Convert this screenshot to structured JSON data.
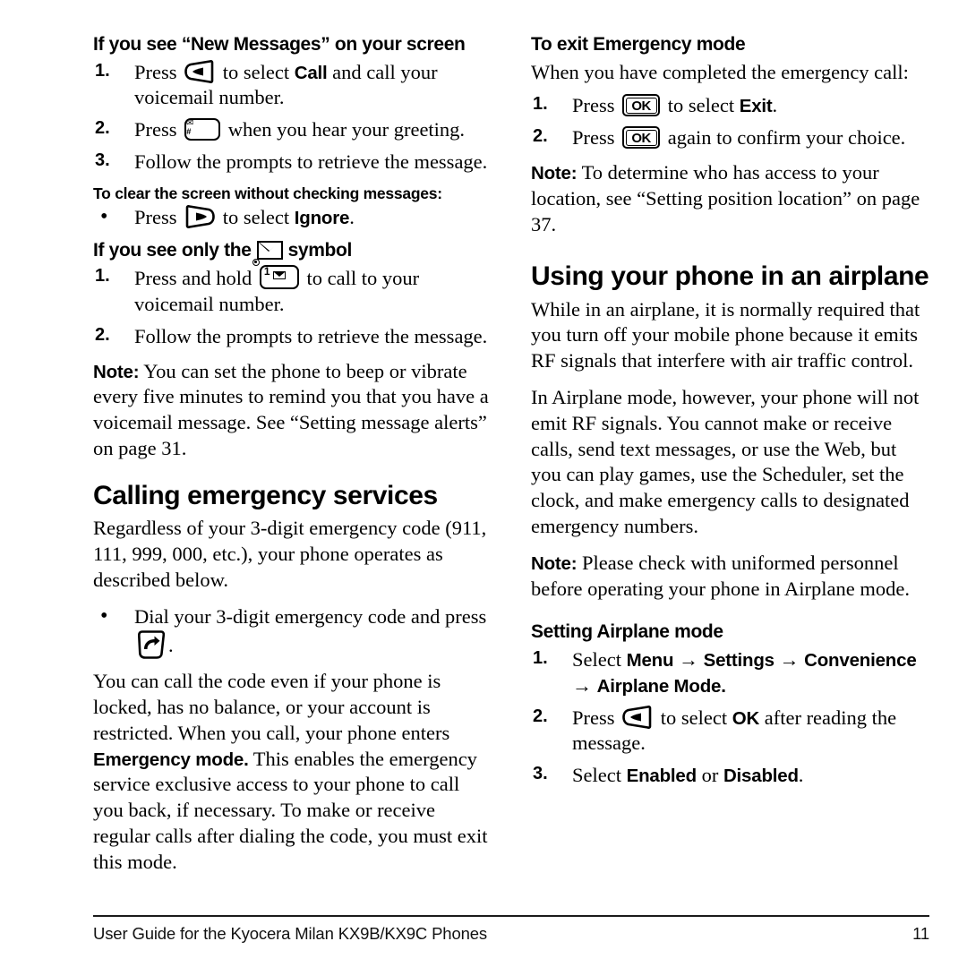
{
  "document": {
    "page_number": "11",
    "footer_text": "User Guide for the Kyocera Milan KX9B/KX9C Phones"
  },
  "left_column": {
    "heading_new_messages": "If you see “New Messages” on your screen",
    "steps_new_messages": [
      {
        "num": "1.",
        "pre": "Press",
        "icon": "left-softkey-icon",
        "mid": "to select",
        "bold": "Call",
        "post": "and call your voicemail number."
      },
      {
        "num": "2.",
        "pre": "Press",
        "icon": "space-pound-key-icon",
        "mid": "when you hear your greeting.",
        "bold": "",
        "post": ""
      },
      {
        "num": "3.",
        "pre": "Follow the prompts to retrieve the message.",
        "icon": "",
        "mid": "",
        "bold": "",
        "post": ""
      }
    ],
    "minor_heading_clear_screen": "To clear the screen without checking messages:",
    "bullet_ignore": {
      "pre": "Press",
      "icon": "right-softkey-icon",
      "mid": "to select",
      "bold": "Ignore",
      "post": "."
    },
    "heading_envelope_pre": "If you see only the",
    "heading_envelope_icon": "envelope-icon",
    "heading_envelope_post": "symbol",
    "steps_envelope": [
      {
        "num": "1.",
        "pre": "Press and hold",
        "icon": "voicemail-one-key-icon",
        "post": "to call to your voicemail number."
      },
      {
        "num": "2.",
        "pre": "Follow the prompts to retrieve the message.",
        "icon": "",
        "post": ""
      }
    ],
    "note_voicemail_label": "Note:",
    "note_voicemail_text": "You can set the phone to beep or vibrate every five minutes to remind you that you have a voicemail message. See “Setting message alerts” on page 31.",
    "heading_emergency": "Calling emergency services",
    "para_emergency_intro": "Regardless of your 3-digit emergency code (911, 111, 999, 000, etc.), your phone operates as described below.",
    "bullet_dial": {
      "pre": "Dial  your 3-digit emergency code and press",
      "icon": "send-talk-key-icon",
      "post": "."
    },
    "para_emergency_body_1": "You can call the code even if your phone is locked, has no balance, or your account is restricted. When you call, your phone enters ",
    "para_emergency_bold": "Emergency mode.",
    "para_emergency_body_2": " This enables the emergency service exclusive access to your phone to call you back, if necessary. To make or receive regular calls after dialing the code, you must exit this mode."
  },
  "right_column": {
    "heading_exit_emergency": "To exit Emergency mode",
    "para_exit_intro": "When you have completed the emergency call:",
    "steps_exit": [
      {
        "num": "1.",
        "pre": "Press",
        "icon": "ok-key-icon",
        "mid": "to select",
        "bold": "Exit",
        "post": "."
      },
      {
        "num": "2.",
        "pre": "Press",
        "icon": "ok-key-icon",
        "mid": "again to confirm your choice.",
        "bold": "",
        "post": ""
      }
    ],
    "note_location_label": "Note:",
    "note_location_text": "To determine who has access to your location, see “Setting position location” on page 37.",
    "heading_airplane": "Using your phone in an airplane",
    "para_airplane_1": "While in an airplane, it is normally required that you turn off your mobile phone because it emits RF signals that interfere with air traffic control.",
    "para_airplane_2": "In Airplane mode, however, your phone will not emit RF signals. You cannot make or receive calls, send text messages, or use the Web, but you can play games, use the Scheduler, set the clock, and make emergency calls to designated emergency numbers.",
    "note_uniformed_label": "Note:",
    "note_uniformed_text": "Please check with uniformed personnel before operating your phone in Airplane mode.",
    "heading_setting_airplane": "Setting Airplane mode",
    "steps_setting": [
      {
        "num": "1.",
        "pre": "Select",
        "menu_path": [
          "Menu",
          "Settings",
          "Convenience",
          "Airplane Mode."
        ],
        "arrow": "→"
      },
      {
        "num": "2.",
        "pre": "Press",
        "icon": "left-softkey-icon",
        "mid": "to select",
        "bold": "OK",
        "post": "after reading the message."
      },
      {
        "num": "3.",
        "pre": "Select",
        "bold1": "Enabled",
        "mid": "or",
        "bold2": "Disabled",
        "post": "."
      }
    ]
  },
  "colors": {
    "text": "#000000",
    "background": "#ffffff",
    "rule": "#1b1b1b"
  }
}
